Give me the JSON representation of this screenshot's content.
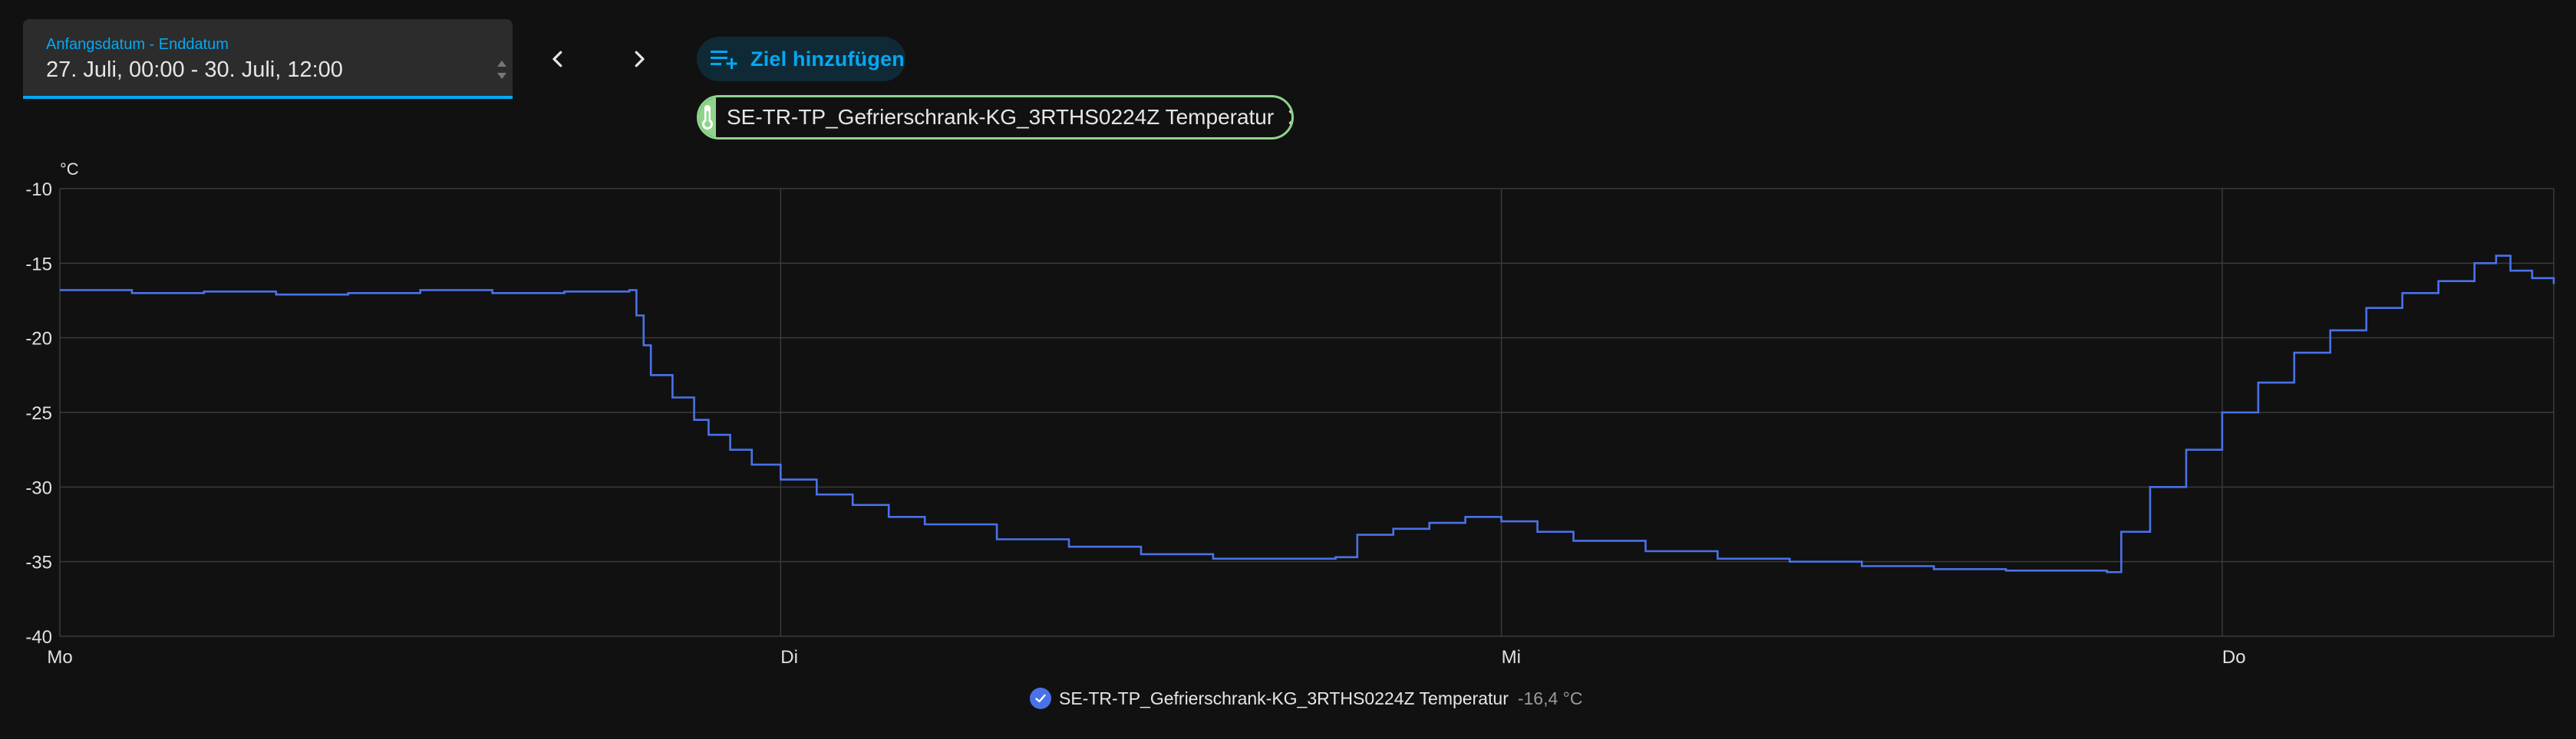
{
  "date_range": {
    "label": "Anfangsdatum - Enddatum",
    "value": "27. Juli, 00:00 - 30. Juli, 12:00"
  },
  "nav": {
    "prev_icon": "chevron-left-icon",
    "next_icon": "chevron-right-icon"
  },
  "add_target": {
    "label": "Ziel hinzufügen",
    "icon": "playlist-plus-icon"
  },
  "entity_chip": {
    "label": "SE-TR-TP_Gefrierschrank-KG_3RTHS0224Z Temperatur",
    "icon": "thermometer-icon",
    "color": "#8fd48a"
  },
  "legend": {
    "name": "SE-TR-TP_Gefrierschrank-KG_3RTHS0224Z Temperatur",
    "value": "-16,4 °C",
    "color": "#4a72e8"
  },
  "colors": {
    "accent": "#03a9f4",
    "line": "#4a72e8",
    "background": "#111111"
  },
  "chart_data": {
    "type": "line",
    "ylabel": "°C",
    "ylim": [
      -40,
      -10
    ],
    "yticks": [
      "-10",
      "-15",
      "-20",
      "-25",
      "-30",
      "-35",
      "-40"
    ],
    "xlim": [
      0,
      3.46
    ],
    "xticks": [
      {
        "x": 0,
        "label": "Mo"
      },
      {
        "x": 1,
        "label": "Di"
      },
      {
        "x": 2,
        "label": "Mi"
      },
      {
        "x": 3,
        "label": "Do"
      }
    ],
    "grid": true,
    "series": [
      {
        "name": "SE-TR-TP_Gefrierschrank-KG_3RTHS0224Z Temperatur",
        "x": [
          0.0,
          0.1,
          0.2,
          0.3,
          0.4,
          0.5,
          0.6,
          0.7,
          0.79,
          0.8,
          0.81,
          0.82,
          0.85,
          0.88,
          0.9,
          0.93,
          0.96,
          1.0,
          1.05,
          1.1,
          1.15,
          1.2,
          1.3,
          1.4,
          1.5,
          1.6,
          1.7,
          1.77,
          1.8,
          1.85,
          1.9,
          1.95,
          2.0,
          2.05,
          2.1,
          2.2,
          2.3,
          2.4,
          2.5,
          2.6,
          2.7,
          2.8,
          2.84,
          2.86,
          2.9,
          2.95,
          3.0,
          3.05,
          3.1,
          3.15,
          3.2,
          3.25,
          3.3,
          3.35,
          3.38,
          3.4,
          3.43,
          3.46
        ],
        "values": [
          -16.8,
          -17.0,
          -16.9,
          -17.1,
          -17.0,
          -16.8,
          -17.0,
          -16.9,
          -16.8,
          -18.5,
          -20.5,
          -22.5,
          -24.0,
          -25.5,
          -26.5,
          -27.5,
          -28.5,
          -29.5,
          -30.5,
          -31.2,
          -32.0,
          -32.5,
          -33.5,
          -34.0,
          -34.5,
          -34.8,
          -34.8,
          -34.7,
          -33.2,
          -32.8,
          -32.4,
          -32.0,
          -32.3,
          -33.0,
          -33.6,
          -34.3,
          -34.8,
          -35.0,
          -35.3,
          -35.5,
          -35.6,
          -35.6,
          -35.7,
          -33.0,
          -30.0,
          -27.5,
          -25.0,
          -23.0,
          -21.0,
          -19.5,
          -18.0,
          -17.0,
          -16.2,
          -15.0,
          -14.5,
          -15.5,
          -16.0,
          -16.4
        ]
      }
    ]
  }
}
